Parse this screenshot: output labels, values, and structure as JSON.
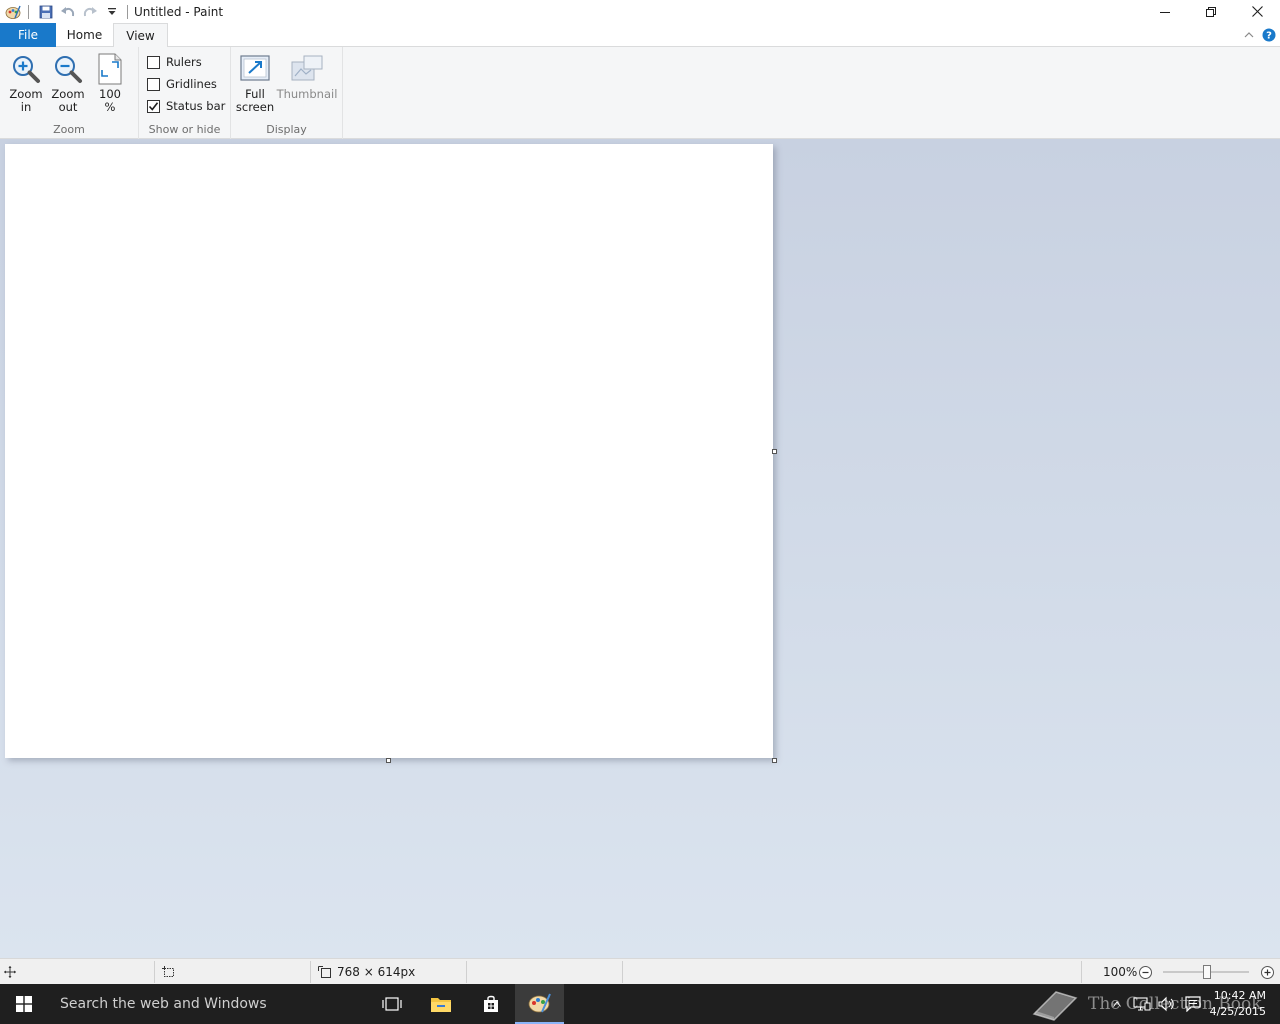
{
  "window": {
    "title": "Untitled - Paint"
  },
  "tabs": [
    {
      "label": "File"
    },
    {
      "label": "Home"
    },
    {
      "label": "View"
    }
  ],
  "ribbon": {
    "zoom_group": {
      "label": "Zoom",
      "zoom_in": [
        "Zoom",
        "in"
      ],
      "zoom_out": [
        "Zoom",
        "out"
      ],
      "zoom_100": [
        "100",
        "%"
      ]
    },
    "show_hide_group": {
      "label": "Show or hide",
      "rulers": {
        "label": "Rulers",
        "checked": false
      },
      "gridlines": {
        "label": "Gridlines",
        "checked": false
      },
      "status_bar": {
        "label": "Status bar",
        "checked": true
      }
    },
    "display_group": {
      "label": "Display",
      "full_screen": [
        "Full",
        "screen"
      ],
      "thumbnail": "Thumbnail"
    }
  },
  "status": {
    "canvas_size": "768 × 614px",
    "zoom_level": "100%"
  },
  "taskbar": {
    "search_placeholder": "Search the web and Windows",
    "time": "10:42 AM",
    "date": "4/25/2015",
    "watermark": "The Collection Book"
  },
  "colors": {
    "file_tab": "#1979ca",
    "ribbon_bg": "#f5f6f7",
    "workspace_top": "#c8d1e1",
    "workspace_bottom": "#dbe4ef",
    "taskbar": "#1f1f1f"
  }
}
